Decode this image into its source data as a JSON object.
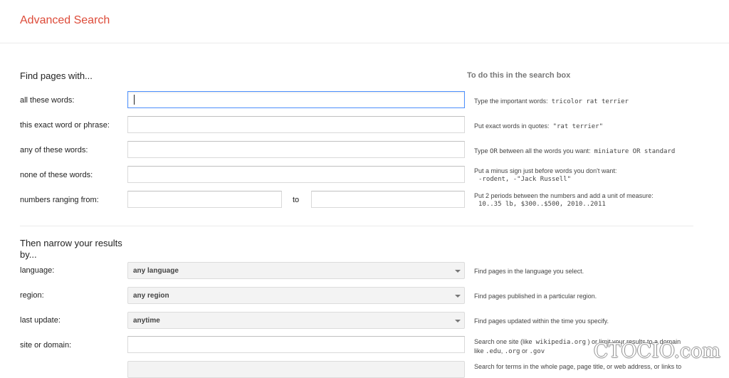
{
  "header": {
    "title": "Advanced Search"
  },
  "find_section": {
    "title": "Find pages with...",
    "hint_title": "To do this in the search box",
    "rows": [
      {
        "label": "all these words:",
        "value": "",
        "hint_text": "Type the important words:",
        "hint_example": "tricolor rat terrier"
      },
      {
        "label": "this exact word or phrase:",
        "value": "",
        "hint_text": "Put exact words in quotes:",
        "hint_example": "\"rat terrier\""
      },
      {
        "label": "any of these words:",
        "value": "",
        "hint_text_1": "Type",
        "hint_or": "OR",
        "hint_text_2": "between all the words you want:",
        "hint_example": "miniature OR standard"
      },
      {
        "label": "none of these words:",
        "value": "",
        "hint_text": "Put a minus sign just before words you don't want:",
        "hint_example": "-rodent, -\"Jack Russell\""
      },
      {
        "label": "numbers ranging from:",
        "from_value": "",
        "to_label": "to",
        "to_value": "",
        "hint_text": "Put 2 periods between the numbers and add a unit of measure:",
        "hint_example": "10..35 lb, $300..$500, 2010..2011"
      }
    ]
  },
  "narrow_section": {
    "title_line1": "Then narrow your results",
    "title_line2": "by...",
    "rows": [
      {
        "label": "language:",
        "selected": "any language",
        "hint_text": "Find pages in the language you select."
      },
      {
        "label": "region:",
        "selected": "any region",
        "hint_text": "Find pages published in a particular region."
      },
      {
        "label": "last update:",
        "selected": "anytime",
        "hint_text": "Find pages updated within the time you specify."
      },
      {
        "label": "site or domain:",
        "value": "",
        "hint_part1": "Search one site (like",
        "hint_code1": "wikipedia.org",
        "hint_part2": ") or limit your results to a domain",
        "hint_part3": "like",
        "hint_code2": ".edu",
        "hint_code3": ".org",
        "hint_or": "or",
        "hint_code4": ".gov"
      },
      {
        "hint_text": "Search for terms in the whole page, page title, or web address, or links to"
      }
    ]
  },
  "watermark": "CTOCIO.com",
  "colors": {
    "title": "#dd4b39",
    "focus_border": "#4d90fe",
    "select_bg": "#f3f3f3"
  }
}
